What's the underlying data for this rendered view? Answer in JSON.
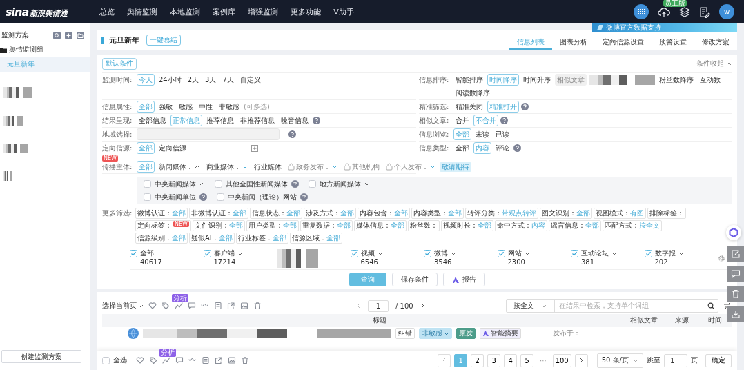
{
  "nav": {
    "logo_mark": "sina",
    "logo_text": "新浪舆情通",
    "items": [
      "总览",
      "舆情监测",
      "本地监测",
      "案例库",
      "增强监测",
      "更多功能",
      "V助手"
    ],
    "badge": "员工版",
    "avatar": "w"
  },
  "sidebar": {
    "title": "监测方案",
    "group": "舆情监测组",
    "items": [
      {
        "label": "元旦新年",
        "selected": true
      }
    ],
    "create_button": "创建监测方案"
  },
  "plan": {
    "title": "元旦新年",
    "summary_button": "一键总结",
    "banner": "微博官方数据支持",
    "tabs": [
      {
        "label": "信息列表",
        "selected": true
      },
      {
        "label": "图表分析",
        "selected": false
      },
      {
        "label": "定向信源设置",
        "selected": false
      },
      {
        "label": "预警设置",
        "selected": false
      },
      {
        "label": "修改方案",
        "selected": false
      }
    ]
  },
  "filters": {
    "default_button": "默认条件",
    "collapse": "条件收起",
    "left": [
      {
        "label": "监测时间:",
        "options": [
          {
            "text": "今天",
            "selected": true
          },
          {
            "text": "24小时",
            "selected": false
          },
          {
            "text": "2天",
            "selected": false
          },
          {
            "text": "3天",
            "selected": false
          },
          {
            "text": "7天",
            "selected": false
          },
          {
            "text": "自定义",
            "selected": false
          }
        ]
      },
      {
        "label": "信息属性:",
        "options": [
          {
            "text": "全部",
            "selected": true
          },
          {
            "text": "强敏",
            "selected": false
          },
          {
            "text": "敏感",
            "selected": false
          },
          {
            "text": "中性",
            "selected": false
          },
          {
            "text": "非敏感",
            "selected": false
          }
        ],
        "note": "(可多选)"
      },
      {
        "label": "结果呈现:",
        "options": [
          {
            "text": "全部信息",
            "selected": false
          },
          {
            "text": "正常信息",
            "selected": true
          },
          {
            "text": "推荐信息",
            "selected": false
          },
          {
            "text": "非推荐信息",
            "selected": false
          },
          {
            "text": "噪音信息",
            "selected": false
          }
        ],
        "help": true
      },
      {
        "label": "地域选择:",
        "kind": "field",
        "help": true
      },
      {
        "label": "定向信源:",
        "options": [
          {
            "text": "全部",
            "selected": true
          },
          {
            "text": "定向信源",
            "selected": false
          }
        ],
        "add": true
      },
      {
        "label": "传播主体:",
        "badge": "NEW",
        "options": [
          {
            "text": "全部",
            "selected": true
          },
          {
            "text": "新闻媒体：",
            "selected": false,
            "expanded": true
          },
          {
            "text": "商业媒体：",
            "selected": false,
            "expanded": false
          },
          {
            "text": "行业媒体",
            "selected": false
          },
          {
            "text": "政务发布：",
            "selected": false,
            "locked": true,
            "expanded": false
          },
          {
            "text": "其他机构",
            "selected": false,
            "locked": true
          },
          {
            "text": "个人发布：",
            "selected": false,
            "locked": true,
            "expanded": false
          }
        ],
        "tag": "敬请期待"
      }
    ],
    "right": [
      {
        "label": "信息排序:",
        "options": [
          {
            "kind": "option",
            "text": "智能排序",
            "selected": false
          },
          {
            "kind": "option",
            "text": "时间降序",
            "selected": true
          },
          {
            "kind": "option",
            "text": "时间升序",
            "selected": false
          },
          {
            "kind": "option",
            "text": "相似文章",
            "selected": false,
            "disabled": true
          },
          {
            "kind": "blur"
          },
          {
            "kind": "option",
            "text": "粉丝数降序",
            "selected": false
          },
          {
            "kind": "option",
            "text": "互动数",
            "selected": false
          },
          {
            "kind": "option",
            "text": "阅读数降序",
            "selected": false
          }
        ]
      },
      {
        "label": "精准筛选:",
        "options": [
          {
            "text": "精准关闭",
            "selected": false
          },
          {
            "text": "精准打开",
            "selected": true
          }
        ],
        "help": true
      },
      {
        "label": "相似文章:",
        "options": [
          {
            "text": "合并",
            "selected": false
          },
          {
            "text": "不合并",
            "selected": true
          }
        ],
        "help": true
      },
      {
        "label": "信息浏览:",
        "options": [
          {
            "text": "全部",
            "selected": true
          },
          {
            "text": "未读",
            "selected": false
          },
          {
            "text": "已读",
            "selected": false
          }
        ]
      },
      {
        "label": "信息类型:",
        "options": [
          {
            "text": "全部",
            "selected": false
          },
          {
            "text": "内容",
            "selected": true
          },
          {
            "text": "评论",
            "selected": false
          }
        ],
        "help": true
      }
    ],
    "media_panel": [
      [
        {
          "text": "中央新闻媒体",
          "checked": false,
          "expanded": true
        },
        {
          "text": "其他全国性新闻媒体",
          "checked": false,
          "help": true
        },
        {
          "text": "地方新闻媒体",
          "checked": false,
          "expanded": false
        }
      ],
      [
        {
          "text": "中央新闻单位",
          "checked": false,
          "help": true
        },
        {
          "text": "中央新闻（理论）网站",
          "checked": false,
          "help": true
        }
      ]
    ],
    "more_label": "更多筛选:",
    "more": [
      {
        "label": "微博认证：",
        "value": "全部"
      },
      {
        "label": "非微博认证：",
        "value": "全部"
      },
      {
        "label": "信息状态：",
        "value": "全部"
      },
      {
        "label": "涉及方式：",
        "value": "全部"
      },
      {
        "label": "内容包含：",
        "value": "全部"
      },
      {
        "label": "内容类型：",
        "value": "全部"
      },
      {
        "label": "转评分类：",
        "value": "带观点转评"
      },
      {
        "label": "图文识别：",
        "value": "全部"
      },
      {
        "label": "视图模式：",
        "value": "有图"
      },
      {
        "label": "排除标签："
      },
      {
        "label": "定向标签：",
        "badge": "NEW"
      },
      {
        "label": "文件识别：",
        "value": "全部"
      },
      {
        "label": "用户类型：",
        "value": "全部"
      },
      {
        "label": "重复数据：",
        "value": "全部"
      },
      {
        "label": "媒体信息：",
        "value": "全部"
      },
      {
        "label": "粉丝数："
      },
      {
        "label": "视频时长：",
        "value": "全部"
      },
      {
        "label": "命中方式：",
        "value": "内容"
      },
      {
        "label": "谣言信息：",
        "value": "全部"
      },
      {
        "label": "匹配方式：",
        "value": "按全文"
      },
      {
        "label": "信源级别：",
        "value": "全部"
      },
      {
        "label": "疑似AI：",
        "value": "全部"
      },
      {
        "label": "行业标签：",
        "value": "全部"
      },
      {
        "label": "信源区域：",
        "value": "全部"
      }
    ],
    "sources": [
      {
        "kind": "source",
        "label": "全部",
        "count": "40617",
        "checked": true
      },
      {
        "kind": "source",
        "label": "客户端",
        "count": "17214",
        "checked": true,
        "caret": true
      },
      {
        "kind": "blur"
      },
      {
        "kind": "source",
        "label": "视频",
        "count": "6546",
        "checked": true,
        "caret": true
      },
      {
        "kind": "source",
        "label": "微博",
        "count": "3546",
        "checked": true,
        "caret": true
      },
      {
        "kind": "source",
        "label": "网站",
        "count": "2300",
        "checked": true,
        "caret": true
      },
      {
        "kind": "source",
        "label": "互动论坛",
        "count": "381",
        "checked": true,
        "caret": true
      },
      {
        "kind": "source",
        "label": "数字报",
        "count": "202",
        "checked": true,
        "caret": true
      }
    ],
    "actions": [
      {
        "label": "查询",
        "kind": "primary"
      },
      {
        "label": "保存条件",
        "kind": "plain"
      },
      {
        "label": "报告",
        "kind": "report"
      }
    ]
  },
  "results": {
    "select_page": "选择当前页",
    "analysis_badge": "分析",
    "page": "1",
    "total": "/ 100",
    "search_scope": "按全文",
    "search_placeholder": "在结果中检索，支持单个词组",
    "columns": [
      "标题",
      "相似文章",
      "来源",
      "时间"
    ],
    "row": {
      "tags": [
        {
          "text": "纠错",
          "kind": "plain"
        },
        {
          "text": "非敏感",
          "kind": "sentiment"
        },
        {
          "text": "原发",
          "kind": "origin"
        },
        {
          "text": "智能摘要",
          "kind": "ai"
        }
      ],
      "published": "发布于："
    },
    "footer": {
      "select_all": "全选",
      "checked": false,
      "analysis_badge": "分析",
      "pages": [
        {
          "text": "1",
          "selected": true
        },
        {
          "text": "2",
          "selected": false
        },
        {
          "text": "3",
          "selected": false
        },
        {
          "text": "4",
          "selected": false
        },
        {
          "text": "5",
          "selected": false
        }
      ],
      "ellipsis": "···",
      "last": "100",
      "page_size": "50 条/页",
      "jump": "跳至",
      "jump_value": "1",
      "page_unit": "页",
      "confirm": "确定"
    }
  }
}
